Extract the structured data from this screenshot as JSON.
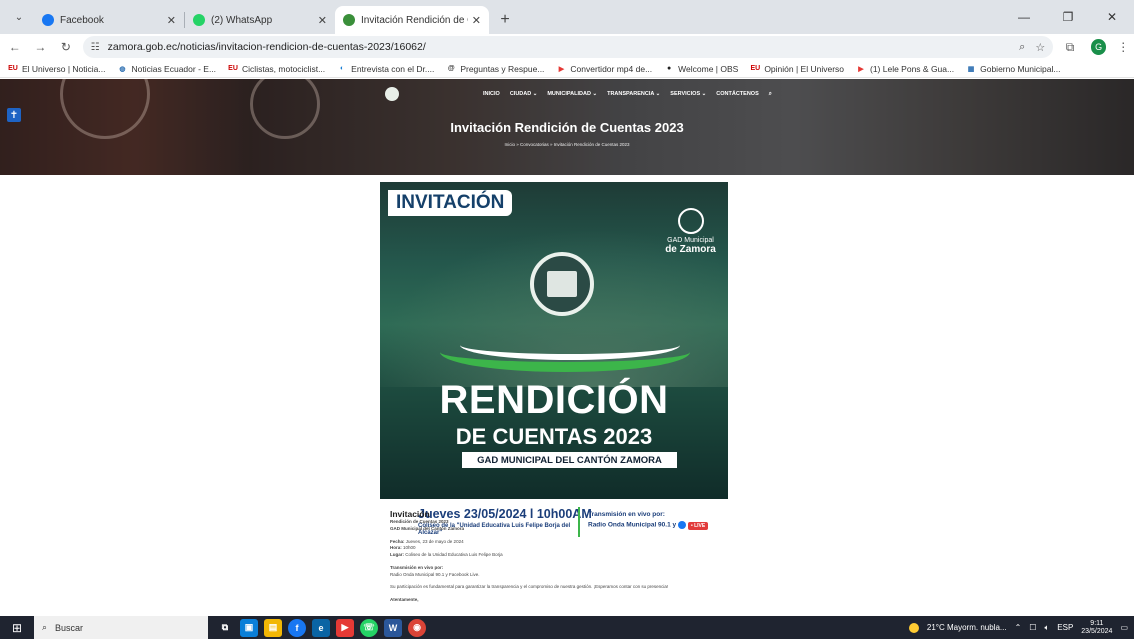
{
  "browser": {
    "tabs": [
      {
        "title": "Facebook",
        "favicon_color": "#1877f2",
        "active": false
      },
      {
        "title": "(2) WhatsApp",
        "favicon_color": "#25d366",
        "active": false
      },
      {
        "title": "Invitación Rendición de Cuenta",
        "favicon_color": "#3a8f3a",
        "active": true
      }
    ],
    "url": "zamora.gob.ec/noticias/invitacion-rendicion-de-cuentas-2023/16062/",
    "profile_initial": "G",
    "bookmarks": [
      {
        "icon": "EU",
        "label": "El Universo | Noticia..."
      },
      {
        "icon": "◍",
        "label": "Noticias Ecuador - E..."
      },
      {
        "icon": "EU",
        "label": "Ciclistas, motociclist..."
      },
      {
        "icon": "◐",
        "label": "Entrevista con el Dr...."
      },
      {
        "icon": "@",
        "label": "Preguntas y Respue..."
      },
      {
        "icon": "▶",
        "label": "Convertidor mp4 de..."
      },
      {
        "icon": "●",
        "label": "Welcome | OBS"
      },
      {
        "icon": "EU",
        "label": "Opinión | El Universo"
      },
      {
        "icon": "▶",
        "label": "(1) Lele Pons & Gua..."
      },
      {
        "icon": "▦",
        "label": "Gobierno Municipal..."
      }
    ]
  },
  "site": {
    "nav": [
      "INICIO",
      "CIUDAD ⌄",
      "MUNICIPALIDAD ⌄",
      "TRANSPARENCIA ⌄",
      "SERVICIOS ⌄",
      "CONTÁCTENOS",
      "⌕"
    ],
    "page_title": "Invitación Rendición de Cuentas 2023",
    "breadcrumb": "Inicio » Convocatorias » Invitación Rendición de Cuentas 2023"
  },
  "poster": {
    "badge": "INVITACIÓN",
    "gad_line1": "GAD Municipal",
    "gad_line2": "de Zamora",
    "headline1": "RENDICIÓN",
    "headline2": "DE CUENTAS 2023",
    "strip": "GAD MUNICIPAL DEL CANTÓN ZAMORA",
    "date": "Jueves 23/05/2024 l 10h00AM",
    "place": "Coliseo de la \"Unidad Educativa Luis Felipe Borja del Alcázar\"",
    "transmission1": "Transmisión en vivo por:",
    "transmission2": "Radio Onda Municipal 90.1 y",
    "live": "• LIVE"
  },
  "article": {
    "heading": "Invitación",
    "line1": "Rendición de Cuentas 2023",
    "line2": "GAD Municipal del Cantón Zamora",
    "fecha_label": "Fecha:",
    "fecha": "Jueves, 23 de mayo de 2024",
    "hora_label": "Hora:",
    "hora": "10h00",
    "lugar_label": "Lugar:",
    "lugar": "Coliseo de la Unidad Educativa Luis Felipe Borja",
    "tx_label": "Transmisión en vivo por:",
    "tx": "Radio Onda Municipal 90.1 y Facebook Live.",
    "message": "Su participación es fundamental para garantizar la transparencia y el compromiso de nuestra gestión. ¡Esperamos contar con su presencia!",
    "closing": "Atentamente,"
  },
  "taskbar": {
    "search_placeholder": "Buscar",
    "weather": "21°C  Mayorm. nubla...",
    "lang": "ESP",
    "time": "9:11",
    "date": "23/5/2024"
  }
}
